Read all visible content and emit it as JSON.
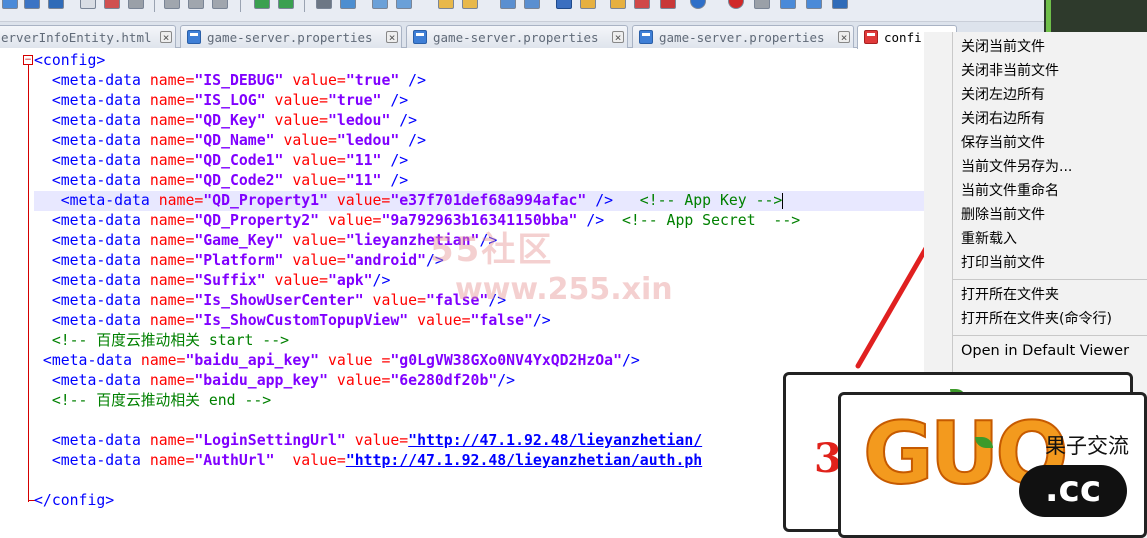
{
  "tabs": [
    {
      "label": "erverInfoEntity.html",
      "active": false
    },
    {
      "label": "game-server.properties",
      "active": false
    },
    {
      "label": "game-server.properties",
      "active": false
    },
    {
      "label": "game-server.properties",
      "active": false
    },
    {
      "label": "confi",
      "active": true
    }
  ],
  "editor": {
    "lines": [
      [
        [
          "t",
          "<config>"
        ]
      ],
      [
        [
          "t",
          "  <meta-data "
        ],
        [
          "a",
          "name="
        ],
        [
          "v",
          "\"IS_DEBUG\""
        ],
        [
          "a",
          " value="
        ],
        [
          "v",
          "\"true\""
        ],
        [
          "t",
          " />"
        ]
      ],
      [
        [
          "t",
          "  <meta-data "
        ],
        [
          "a",
          "name="
        ],
        [
          "v",
          "\"IS_LOG\""
        ],
        [
          "a",
          " value="
        ],
        [
          "v",
          "\"true\""
        ],
        [
          "t",
          " />"
        ]
      ],
      [
        [
          "t",
          "  <meta-data "
        ],
        [
          "a",
          "name="
        ],
        [
          "v",
          "\"QD_Key\""
        ],
        [
          "a",
          " value="
        ],
        [
          "v",
          "\"ledou\""
        ],
        [
          "t",
          " />"
        ]
      ],
      [
        [
          "t",
          "  <meta-data "
        ],
        [
          "a",
          "name="
        ],
        [
          "v",
          "\"QD_Name\""
        ],
        [
          "a",
          " value="
        ],
        [
          "v",
          "\"ledou\""
        ],
        [
          "t",
          " />"
        ]
      ],
      [
        [
          "t",
          "  <meta-data "
        ],
        [
          "a",
          "name="
        ],
        [
          "v",
          "\"QD_Code1\""
        ],
        [
          "a",
          " value="
        ],
        [
          "v",
          "\"11\""
        ],
        [
          "t",
          " />"
        ]
      ],
      [
        [
          "t",
          "  <meta-data "
        ],
        [
          "a",
          "name="
        ],
        [
          "v",
          "\"QD_Code2\""
        ],
        [
          "a",
          " value="
        ],
        [
          "v",
          "\"11\""
        ],
        [
          "t",
          " />"
        ]
      ],
      [
        [
          "t",
          "   <meta-data "
        ],
        [
          "a",
          "name="
        ],
        [
          "v",
          "\"QD_Property1\""
        ],
        [
          "a",
          " value="
        ],
        [
          "v",
          "\"e37f701def68a994afac\""
        ],
        [
          "t",
          " />"
        ],
        [
          "c",
          "   <!-- App Key -->"
        ]
      ],
      [
        [
          "t",
          "  <meta-data "
        ],
        [
          "a",
          "name="
        ],
        [
          "v",
          "\"QD_Property2\""
        ],
        [
          "a",
          " value="
        ],
        [
          "v",
          "\"9a792963b16341150bba\""
        ],
        [
          "t",
          " />"
        ],
        [
          "c",
          "  <!-- App Secret  -->"
        ]
      ],
      [
        [
          "t",
          "  <meta-data "
        ],
        [
          "a",
          "name="
        ],
        [
          "v",
          "\"Game_Key\""
        ],
        [
          "a",
          " value="
        ],
        [
          "v",
          "\"lieyanzhetian\""
        ],
        [
          "t",
          "/>"
        ]
      ],
      [
        [
          "t",
          "  <meta-data "
        ],
        [
          "a",
          "name="
        ],
        [
          "v",
          "\"Platform\""
        ],
        [
          "a",
          " value="
        ],
        [
          "v",
          "\"android\""
        ],
        [
          "t",
          "/>"
        ]
      ],
      [
        [
          "t",
          "  <meta-data "
        ],
        [
          "a",
          "name="
        ],
        [
          "v",
          "\"Suffix\""
        ],
        [
          "a",
          " value="
        ],
        [
          "v",
          "\"apk\""
        ],
        [
          "t",
          "/>"
        ]
      ],
      [
        [
          "t",
          "  <meta-data "
        ],
        [
          "a",
          "name="
        ],
        [
          "v",
          "\"Is_ShowUserCenter\""
        ],
        [
          "a",
          " value="
        ],
        [
          "v",
          "\"false\""
        ],
        [
          "t",
          "/>"
        ]
      ],
      [
        [
          "t",
          "  <meta-data "
        ],
        [
          "a",
          "name="
        ],
        [
          "v",
          "\"Is_ShowCustomTopupView\""
        ],
        [
          "a",
          " value="
        ],
        [
          "v",
          "\"false\""
        ],
        [
          "t",
          "/>"
        ]
      ],
      [
        [
          "c",
          "  <!-- 百度云推动相关 start -->"
        ]
      ],
      [
        [
          "t",
          " <meta-data "
        ],
        [
          "a",
          "name="
        ],
        [
          "v",
          "\"baidu_api_key\""
        ],
        [
          "a",
          " value ="
        ],
        [
          "v",
          "\"g0LgVW38GXo0NV4YxQD2HzOa\""
        ],
        [
          "t",
          "/>"
        ]
      ],
      [
        [
          "t",
          "  <meta-data "
        ],
        [
          "a",
          "name="
        ],
        [
          "v",
          "\"baidu_app_key\""
        ],
        [
          "a",
          " value="
        ],
        [
          "v",
          "\"6e280df20b\""
        ],
        [
          "t",
          "/>"
        ]
      ],
      [
        [
          "c",
          "  <!-- 百度云推动相关 end -->"
        ]
      ],
      [],
      [
        [
          "t",
          "  <meta-data "
        ],
        [
          "a",
          "name="
        ],
        [
          "v",
          "\"LoginSettingUrl\""
        ],
        [
          "a",
          " value="
        ],
        [
          "u",
          "\"http://47.1.92.48/lieyanzhetian/"
        ]
      ],
      [
        [
          "t",
          "  <meta-data "
        ],
        [
          "a",
          "name="
        ],
        [
          "v",
          "\"AuthUrl\""
        ],
        [
          "a",
          "  value="
        ],
        [
          "u",
          "\"http://47.1.92.48/lieyanzhetian/auth.ph"
        ]
      ],
      [],
      [
        [
          "t",
          "</config>"
        ]
      ]
    ],
    "highlight_line": 7
  },
  "context_menu": {
    "group1": [
      "关闭当前文件",
      "关闭非当前文件",
      "关闭左边所有",
      "关闭右边所有",
      "保存当前文件",
      "当前文件另存为...",
      "当前文件重命名",
      "删除当前文件",
      "重新载入",
      "打印当前文件"
    ],
    "group2": [
      "打开所在文件夹",
      "打开所在文件夹(命令行)"
    ],
    "group3": [
      "Open in Default Viewer"
    ]
  },
  "watermark": {
    "site_cn": "55社区",
    "site_url": "www.255.xin"
  },
  "logo": {
    "letters": "GUO",
    "tagline": "果子交流",
    "domain": ".cc",
    "partial_digit": "3"
  },
  "colors": {
    "tag": "#0000ff",
    "attr": "#ff0000",
    "value": "#8000ff",
    "comment": "#008000",
    "fold": "#d40000",
    "arrow": "#e02020",
    "highlight": "#e8e8ff"
  }
}
